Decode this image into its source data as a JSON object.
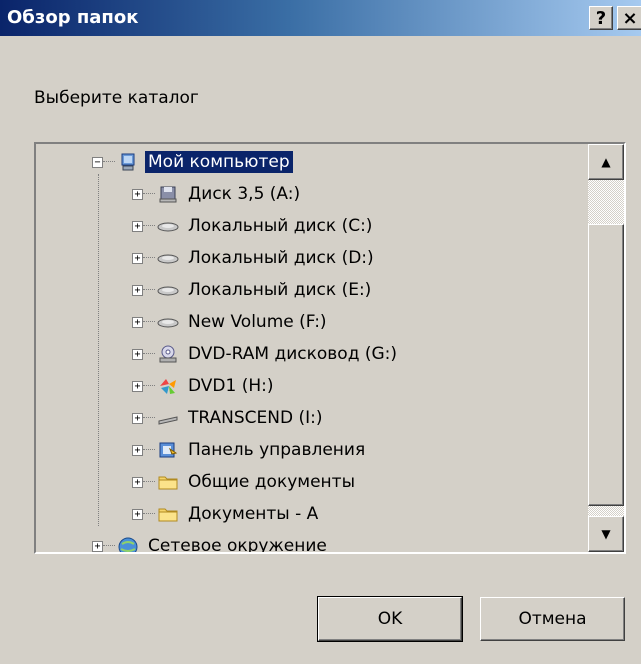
{
  "window": {
    "title": "Обзор папок",
    "help_label": "?",
    "close_label": "×"
  },
  "prompt": "Выберите каталог",
  "tree": {
    "root": {
      "label": "Мой компьютер",
      "icon": "my-computer-icon",
      "expander": "−"
    },
    "items": [
      {
        "label": "Диск 3,5 (A:)",
        "icon": "floppy-drive-icon",
        "expander": "+"
      },
      {
        "label": "Локальный диск (C:)",
        "icon": "hard-drive-icon",
        "expander": "+"
      },
      {
        "label": "Локальный диск (D:)",
        "icon": "hard-drive-icon",
        "expander": "+"
      },
      {
        "label": "Локальный диск (E:)",
        "icon": "hard-drive-icon",
        "expander": "+"
      },
      {
        "label": "New Volume (F:)",
        "icon": "hard-drive-icon",
        "expander": "+"
      },
      {
        "label": "DVD-RAM дисковод (G:)",
        "icon": "dvd-drive-icon",
        "expander": "+"
      },
      {
        "label": "DVD1 (H:)",
        "icon": "dvd-autorun-icon",
        "expander": "+"
      },
      {
        "label": "TRANSCEND (I:)",
        "icon": "removable-drive-icon",
        "expander": "+"
      },
      {
        "label": "Панель управления",
        "icon": "control-panel-icon",
        "expander": "+"
      },
      {
        "label": "Общие документы",
        "icon": "folder-icon",
        "expander": "+"
      },
      {
        "label": "Документы - A",
        "icon": "folder-icon",
        "expander": "+"
      }
    ],
    "network": {
      "label": "Сетевое окружение",
      "icon": "network-icon",
      "expander": "+"
    }
  },
  "buttons": {
    "ok": "OK",
    "cancel": "Отмена"
  },
  "colors": {
    "selection": "#0a246a",
    "dialog_bg": "#d4d0c8"
  }
}
